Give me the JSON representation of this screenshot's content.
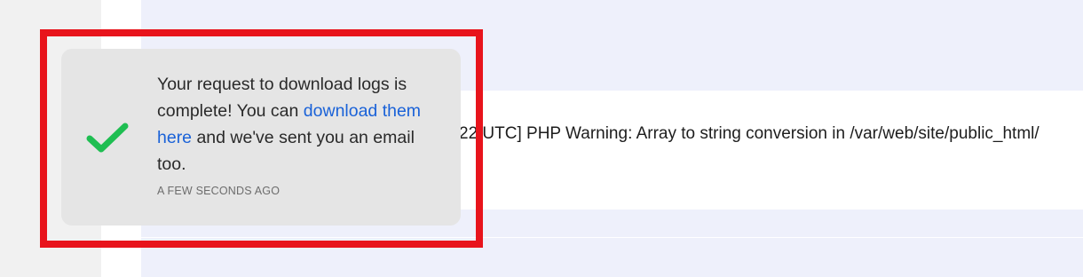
{
  "log": {
    "line_text": "22 UTC] PHP Warning: Array to string conversion in /var/web/site/public_html/"
  },
  "toast": {
    "message_before": "Your request to download logs is complete! You can ",
    "link_text": "download them here",
    "message_after": " and we've sent you an email too.",
    "timestamp": "A FEW SECONDS AGO",
    "icon": "checkmark-icon"
  },
  "colors": {
    "highlight": "#e8141c",
    "check": "#1fbe52",
    "link": "#1a62d8",
    "toast_bg": "#e5e5e5",
    "main_bg": "#eef0fb"
  }
}
